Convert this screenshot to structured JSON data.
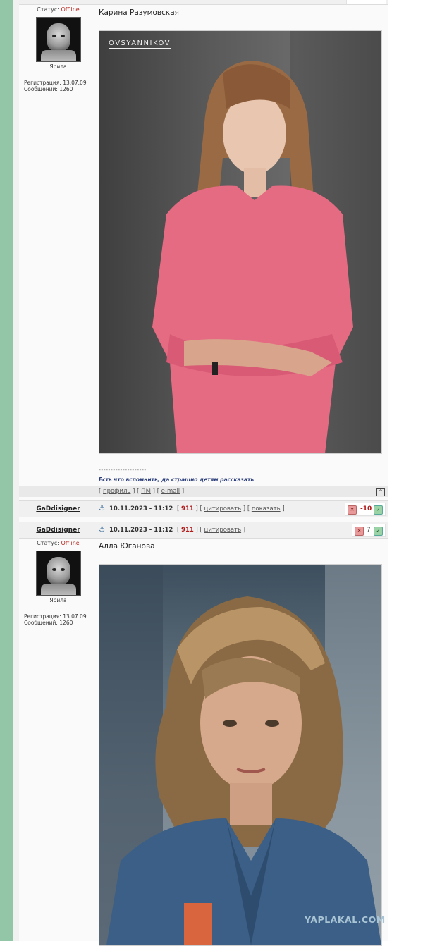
{
  "posts": [
    {
      "status_label": "Статус:",
      "status_value": "Offline",
      "rank": "Ярила",
      "registration": "Регистрация: 13.07.09",
      "messages": "Сообщений: 1260",
      "title": "Карина Разумовская",
      "photo_watermark": "OVSYANNIKOV",
      "signature_line": "--------------------",
      "signature_text": "Есть что вспомнить, да страшно детям рассказать",
      "actions": {
        "profile": "профиль",
        "pm": "ПМ",
        "email": "e-mail"
      }
    },
    {
      "status_label": "Статус:",
      "status_value": "Offline",
      "rank": "Ярила",
      "registration": "Регистрация: 13.07.09",
      "messages": "Сообщений: 1260",
      "title": "Алла Юганова"
    }
  ],
  "headers": [
    {
      "author": "GaDdisigner",
      "date": "10.11.2023 - 11:12",
      "num": "911",
      "quote": "цитировать",
      "show": "показать",
      "rating": "-10"
    },
    {
      "author": "GaDdisigner",
      "date": "10.11.2023 - 11:12",
      "num": "911",
      "quote": "цитировать",
      "rating": "7"
    }
  ],
  "site_watermark": "YAPLAKAL.COM",
  "colors": {
    "offline": "#b31b1b",
    "rating_negative": "#b31b1b",
    "rating_neutral": "#444444",
    "accent_strip": "#93c5a7"
  },
  "icons": {
    "anchor": "anchor-icon",
    "up": "arrow-up-icon",
    "rate_down": "thumb-down-icon",
    "rate_up": "thumb-up-icon"
  }
}
